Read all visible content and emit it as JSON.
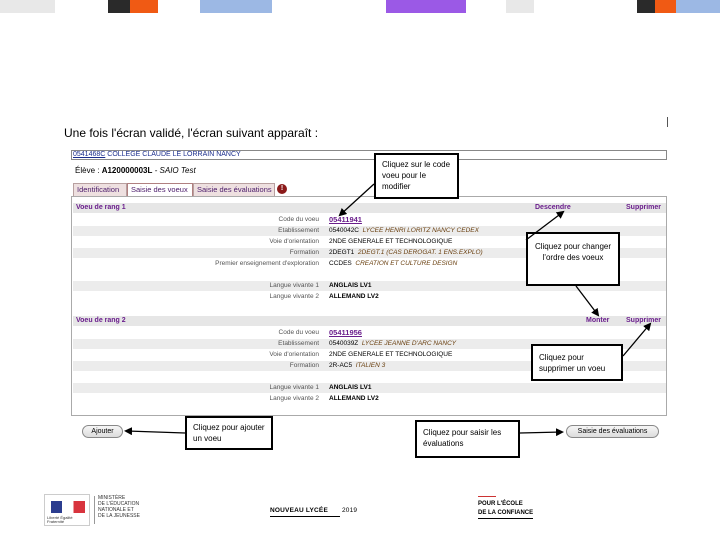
{
  "colors": {
    "topbar": [
      "#e8e8e8",
      "#2a2a2a",
      "#f05a14",
      "#9cb8e4",
      "#9b59e6",
      "#e8e8e8",
      "#2a2a2a",
      "#f05a14",
      "#9cb8e4"
    ],
    "accent": "#6a1e8c",
    "college": "#1a2d8c"
  },
  "slide": {
    "title": "Une fois l'écran validé, l'écran suivant apparaît :"
  },
  "college": {
    "code": "0541468C",
    "name": "COLLEGE CLAUDE LE LORRAIN NANCY"
  },
  "student": {
    "label": "Élève : ",
    "id": "A120000003L",
    "name": " - SAIO Test"
  },
  "tabs": [
    {
      "label": "Identification"
    },
    {
      "label": "Saisie des voeux"
    },
    {
      "label": "Saisie des évaluations"
    }
  ],
  "tab_warning": "!",
  "voeux": [
    {
      "rank_label": "Voeu de rang 1",
      "actions": [
        "Descendre",
        "Supprimer"
      ],
      "code_label": "Code du voeu",
      "code": "05411941",
      "etab_label": "Etablissement",
      "etab_code": "0540042C",
      "etab_name": "LYCEE HENRI LORITZ NANCY CEDEX",
      "voie_label": "Voie d'orientation",
      "voie": "2NDE GENERALE ET TECHNOLOGIQUE",
      "formation_label": "Formation",
      "formation_code": "2DEGT1",
      "formation_name": "2DEGT.1 (CAS DEROGAT. 1 ENS.EXPLO)",
      "premier_label": "Premier enseignement d'exploration",
      "premier_code": "CCDES",
      "premier_name": "CREATION ET CULTURE DESIGN",
      "lv1_label": "Langue vivante 1",
      "lv1": "ANGLAIS LV1",
      "lv2_label": "Langue vivante 2",
      "lv2": "ALLEMAND LV2"
    },
    {
      "rank_label": "Voeu de rang 2",
      "actions": [
        "Monter",
        "Supprimer"
      ],
      "code_label": "Code du voeu",
      "code": "05411956",
      "etab_label": "Etablissement",
      "etab_code": "0540039Z",
      "etab_name": "LYCEE JEANNE D'ARC NANCY",
      "voie_label": "Voie d'orientation",
      "voie": "2NDE GENERALE ET TECHNOLOGIQUE",
      "formation_label": "Formation",
      "formation_code": "2R-AC5",
      "formation_name": "ITALIEN 3",
      "lv1_label": "Langue vivante 1",
      "lv1": "ANGLAIS LV1",
      "lv2_label": "Langue vivante 2",
      "lv2": "ALLEMAND LV2"
    }
  ],
  "buttons": {
    "ajouter": "Ajouter",
    "saisie_evaluations": "Saisie des évaluations"
  },
  "callouts": {
    "code": "Cliquez sur le code voeu pour le modifier",
    "ordre": "Cliquez pour changer l'ordre des voeux",
    "supprimer": "Cliquez pour supprimer un voeu",
    "ajouter": "Cliquez pour ajouter un voeu",
    "evaluations": "Cliquez pour saisir les évaluations"
  },
  "footer": {
    "ministere_lines": [
      "Ministère",
      "de l'Éducation",
      "nationale et",
      "de la Jeunesse"
    ],
    "flag_caption": "Liberté Égalité Fraternité",
    "lycee": "NOUVEAU LYCÉE",
    "lycee_year": "2019",
    "ecole_line1": "POUR L'ÉCOLE",
    "ecole_line2": "DE LA CONFIANCE"
  }
}
